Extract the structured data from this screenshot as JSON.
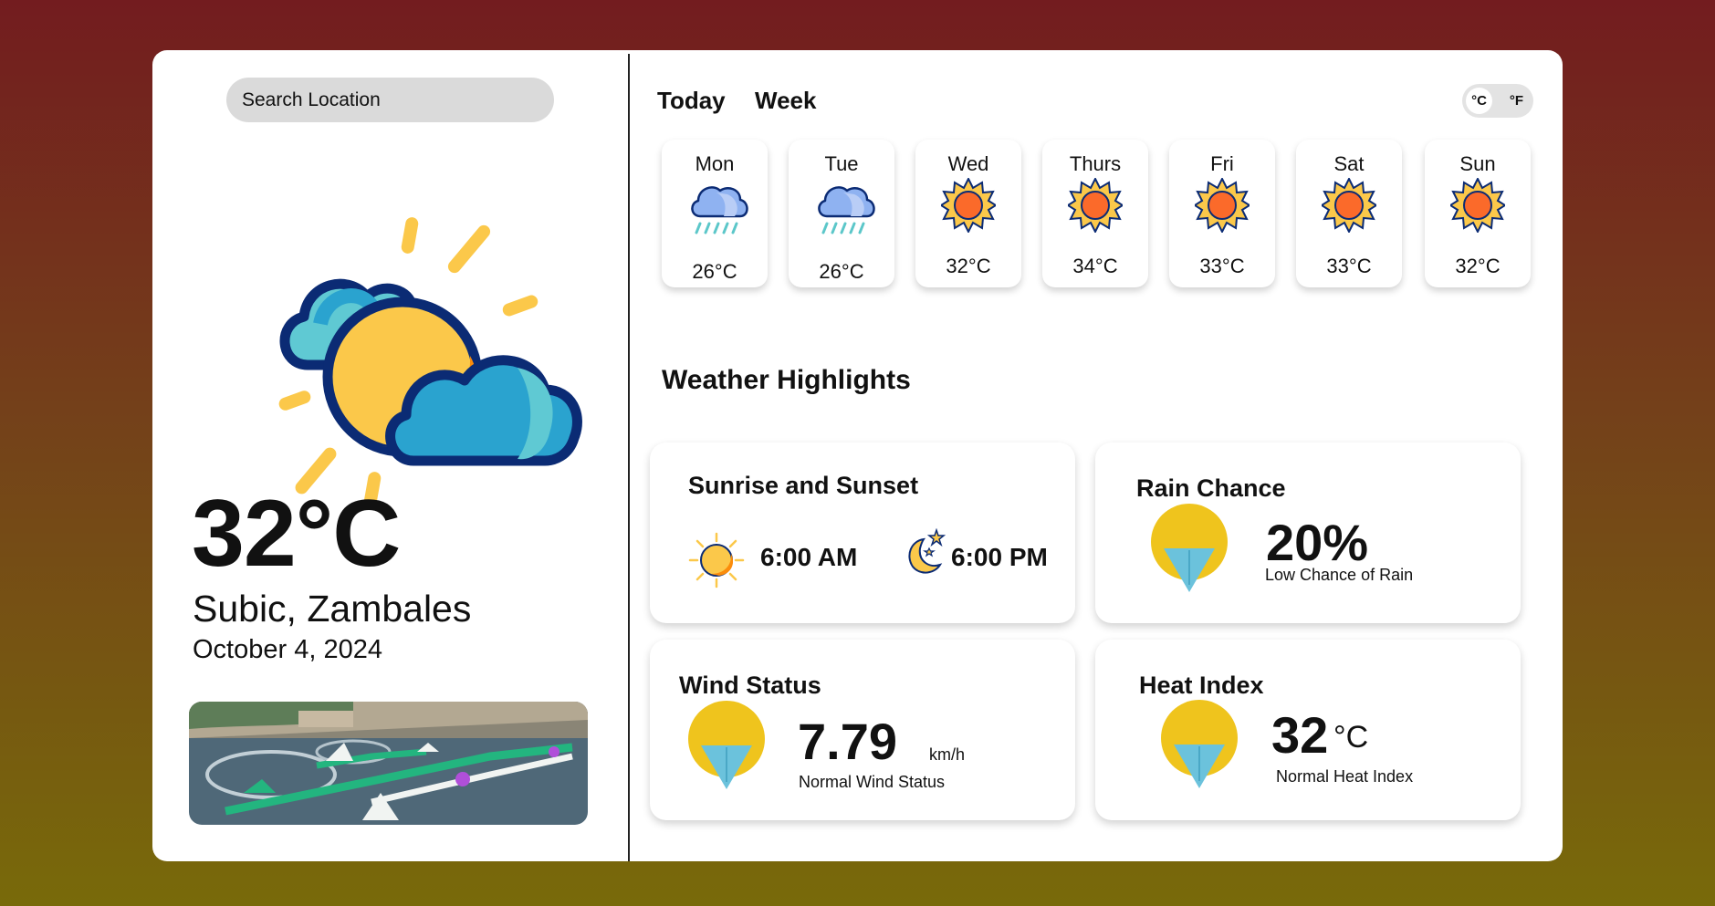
{
  "search": {
    "placeholder": "Search Location"
  },
  "current": {
    "icon": "partly-cloudy-sun-icon",
    "temperature": "32°C",
    "location": "Subic, Zambales",
    "date": "October 4, 2024"
  },
  "tabs": [
    {
      "label": "Today"
    },
    {
      "label": "Week"
    }
  ],
  "units": {
    "celsius": "°C",
    "fahrenheit": "°F",
    "selected": "celsius"
  },
  "week": [
    {
      "day": "Mon",
      "temp": "26°C",
      "icon": "rain-cloud-icon"
    },
    {
      "day": "Tue",
      "temp": "26°C",
      "icon": "rain-cloud-icon"
    },
    {
      "day": "Wed",
      "temp": "32°C",
      "icon": "sun-icon"
    },
    {
      "day": "Thurs",
      "temp": "34°C",
      "icon": "sun-icon"
    },
    {
      "day": "Fri",
      "temp": "33°C",
      "icon": "sun-icon"
    },
    {
      "day": "Sat",
      "temp": "33°C",
      "icon": "sun-icon"
    },
    {
      "day": "Sun",
      "temp": "32°C",
      "icon": "sun-icon"
    }
  ],
  "highlights": {
    "title": "Weather Highlights",
    "sunrise_sunset": {
      "title": "Sunrise and Sunset",
      "sunrise": "6:00 AM",
      "sunset": "6:00 PM"
    },
    "rain": {
      "title": "Rain Chance",
      "value": "20%",
      "desc": "Low Chance of Rain"
    },
    "wind": {
      "title": "Wind Status",
      "value": "7.79",
      "unit": "km/h",
      "desc": "Normal Wind Status"
    },
    "heat": {
      "title": "Heat Index",
      "value": "32",
      "unit": "°C",
      "desc": "Normal Heat Index"
    }
  },
  "colors": {
    "background_top": "#731c1f",
    "background_bottom": "#786a0a",
    "gauge_yellow": "#efc41d",
    "needle_blue": "#6bc2dc"
  }
}
